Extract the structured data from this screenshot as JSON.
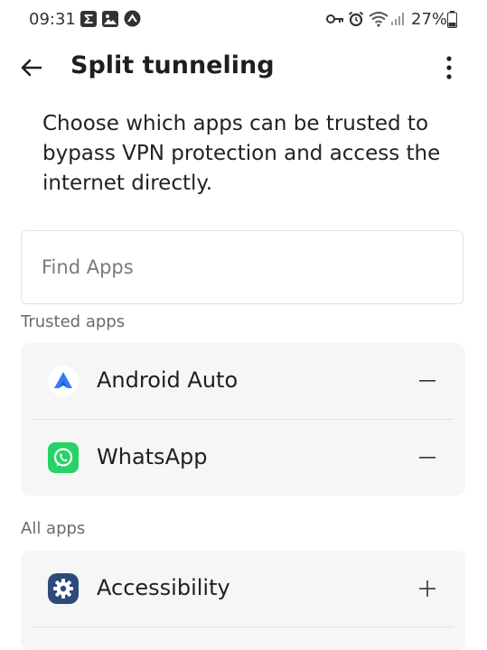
{
  "status_bar": {
    "time": "09:31",
    "battery_percent": "27%",
    "left_icons": [
      "sigma-notification-icon",
      "gallery-notification-icon",
      "vpn-app-notification-icon"
    ],
    "right_icons": [
      "vpn-key-icon",
      "alarm-icon",
      "wifi-icon",
      "signal-icon",
      "battery-icon"
    ]
  },
  "header": {
    "title": "Split tunneling",
    "back_icon": "arrow-left-icon",
    "menu_icon": "more-vertical-icon"
  },
  "description": "Choose which apps can be trusted to bypass VPN protection and access the internet directly.",
  "search": {
    "placeholder": "Find Apps",
    "value": ""
  },
  "trusted_section": {
    "label": "Trusted apps",
    "items": [
      {
        "name": "Android Auto",
        "icon": "android-auto-icon",
        "action": "remove"
      },
      {
        "name": "WhatsApp",
        "icon": "whatsapp-icon",
        "action": "remove"
      }
    ]
  },
  "all_section": {
    "label": "All apps",
    "items": [
      {
        "name": "Accessibility",
        "icon": "accessibility-gear-icon",
        "action": "add"
      }
    ]
  },
  "colors": {
    "card_background": "#f6f6f6",
    "whatsapp_green": "#25d366",
    "android_auto_blue": "#2f7df6",
    "accessibility_navy": "#2c4a7a"
  }
}
